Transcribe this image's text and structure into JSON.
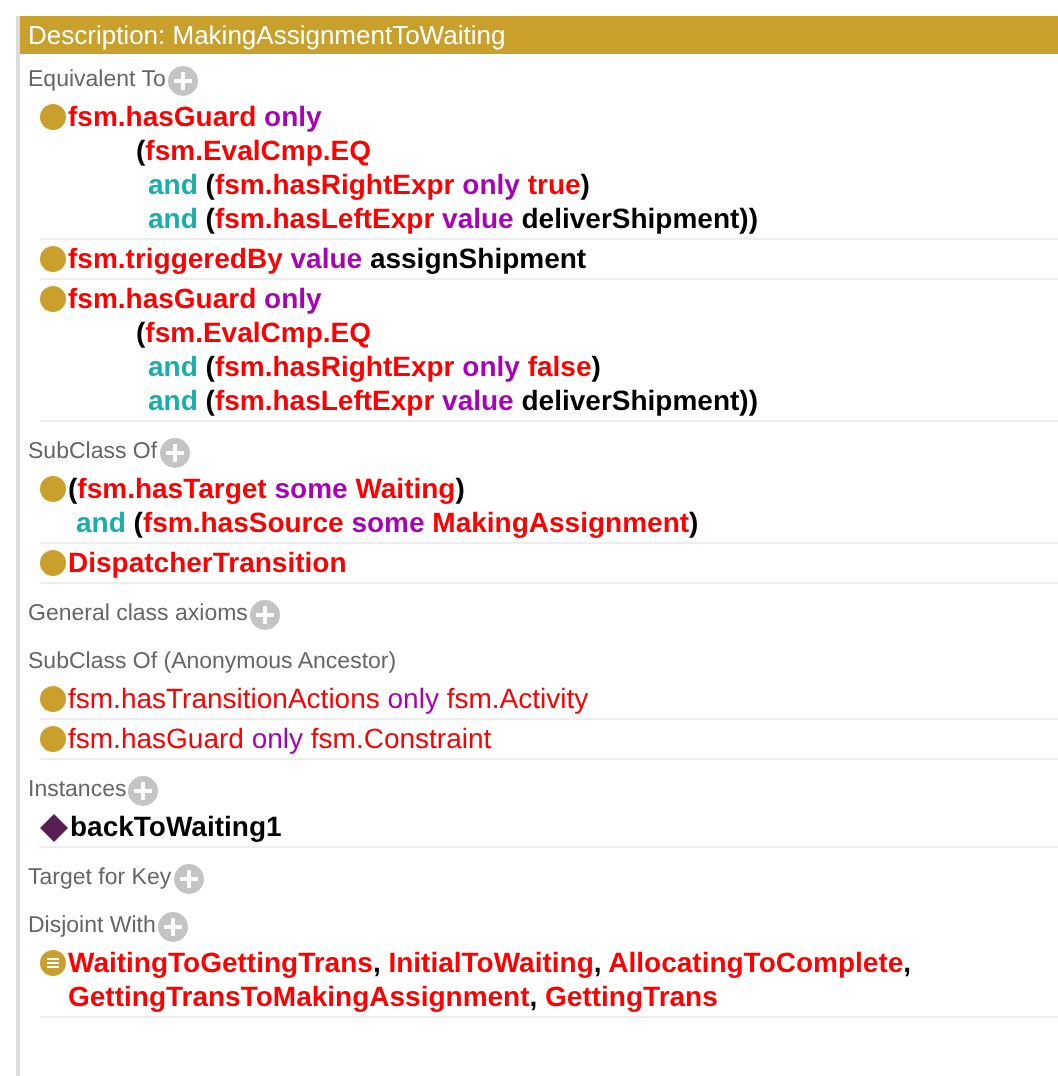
{
  "panel": {
    "title": "Description: MakingAssignmentToWaiting"
  },
  "sections": [
    {
      "label": "Equivalent To",
      "addable": true,
      "items": [
        {
          "kind": "class",
          "inherited": false,
          "lines": [
            {
              "kind": "head",
              "tokens": [
                {
                  "t": "fsm.hasGuard",
                  "kind": "entity"
                },
                {
                  "t": " only",
                  "kind": "keyword"
                }
              ]
            },
            {
              "kind": "group",
              "tokens": [
                {
                  "t": "(",
                  "kind": "plain"
                },
                {
                  "t": "fsm.EvalCmp.EQ",
                  "kind": "entity"
                }
              ]
            },
            {
              "kind": "clause",
              "tokens": [
                {
                  "t": "and",
                  "kind": "connective"
                },
                {
                  "t": " (",
                  "kind": "plain"
                },
                {
                  "t": "fsm.hasRightExpr",
                  "kind": "entity"
                },
                {
                  "t": " only",
                  "kind": "keyword"
                },
                {
                  "t": " true",
                  "kind": "entity"
                },
                {
                  "t": ")",
                  "kind": "plain"
                }
              ]
            },
            {
              "kind": "clause",
              "tokens": [
                {
                  "t": "and",
                  "kind": "connective"
                },
                {
                  "t": " (",
                  "kind": "plain"
                },
                {
                  "t": "fsm.hasLeftExpr",
                  "kind": "entity"
                },
                {
                  "t": " value",
                  "kind": "keyword"
                },
                {
                  "t": " deliverShipment))",
                  "kind": "plain"
                }
              ]
            }
          ]
        },
        {
          "kind": "class",
          "inherited": false,
          "lines": [
            {
              "kind": "head",
              "tokens": [
                {
                  "t": "fsm.triggeredBy",
                  "kind": "entity"
                },
                {
                  "t": " value",
                  "kind": "keyword"
                },
                {
                  "t": " assignShipment",
                  "kind": "plain"
                }
              ]
            }
          ]
        },
        {
          "kind": "class",
          "inherited": false,
          "lines": [
            {
              "kind": "head",
              "tokens": [
                {
                  "t": "fsm.hasGuard",
                  "kind": "entity"
                },
                {
                  "t": " only",
                  "kind": "keyword"
                }
              ]
            },
            {
              "kind": "group",
              "tokens": [
                {
                  "t": "(",
                  "kind": "plain"
                },
                {
                  "t": "fsm.EvalCmp.EQ",
                  "kind": "entity"
                }
              ]
            },
            {
              "kind": "clause",
              "tokens": [
                {
                  "t": "and",
                  "kind": "connective"
                },
                {
                  "t": " (",
                  "kind": "plain"
                },
                {
                  "t": "fsm.hasRightExpr",
                  "kind": "entity"
                },
                {
                  "t": " only",
                  "kind": "keyword"
                },
                {
                  "t": " false",
                  "kind": "entity"
                },
                {
                  "t": ")",
                  "kind": "plain"
                }
              ]
            },
            {
              "kind": "clause",
              "tokens": [
                {
                  "t": "and",
                  "kind": "connective"
                },
                {
                  "t": " (",
                  "kind": "plain"
                },
                {
                  "t": "fsm.hasLeftExpr",
                  "kind": "entity"
                },
                {
                  "t": " value",
                  "kind": "keyword"
                },
                {
                  "t": " deliverShipment))",
                  "kind": "plain"
                }
              ]
            }
          ]
        }
      ]
    },
    {
      "label": "SubClass Of",
      "addable": true,
      "items": [
        {
          "kind": "class",
          "inherited": false,
          "lines": [
            {
              "kind": "head",
              "tokens": [
                {
                  "t": "(",
                  "kind": "plain"
                },
                {
                  "t": "fsm.hasTarget",
                  "kind": "entity"
                },
                {
                  "t": " some",
                  "kind": "keyword"
                },
                {
                  "t": " Waiting",
                  "kind": "entity"
                },
                {
                  "t": ")",
                  "kind": "plain"
                }
              ]
            },
            {
              "kind": "cont",
              "tokens": [
                {
                  "t": "and",
                  "kind": "connective"
                },
                {
                  "t": " (",
                  "kind": "plain"
                },
                {
                  "t": "fsm.hasSource",
                  "kind": "entity"
                },
                {
                  "t": " some",
                  "kind": "keyword"
                },
                {
                  "t": " MakingAssignment",
                  "kind": "entity"
                },
                {
                  "t": ")",
                  "kind": "plain"
                }
              ]
            }
          ]
        },
        {
          "kind": "class",
          "inherited": false,
          "lines": [
            {
              "kind": "head",
              "tokens": [
                {
                  "t": "DispatcherTransition",
                  "kind": "entity"
                }
              ]
            }
          ]
        }
      ]
    },
    {
      "label": "General class axioms",
      "addable": true
    },
    {
      "label": "SubClass Of (Anonymous Ancestor)",
      "addable": false,
      "items": [
        {
          "kind": "class",
          "inherited": true,
          "lines": [
            {
              "kind": "head",
              "tokens": [
                {
                  "t": "fsm.hasTransitionActions",
                  "kind": "entity"
                },
                {
                  "t": " only",
                  "kind": "keyword"
                },
                {
                  "t": " fsm.Activity",
                  "kind": "entity"
                }
              ]
            }
          ]
        },
        {
          "kind": "class",
          "inherited": true,
          "lines": [
            {
              "kind": "head",
              "tokens": [
                {
                  "t": "fsm.hasGuard",
                  "kind": "entity"
                },
                {
                  "t": " only",
                  "kind": "keyword"
                },
                {
                  "t": " fsm.Constraint",
                  "kind": "entity"
                }
              ]
            }
          ]
        }
      ]
    },
    {
      "label": "Instances",
      "addable": true,
      "items": [
        {
          "kind": "individual",
          "inherited": false,
          "lines": [
            {
              "kind": "head",
              "tokens": [
                {
                  "t": "backToWaiting1",
                  "kind": "plain"
                }
              ]
            }
          ]
        }
      ]
    },
    {
      "label": "Target for Key",
      "addable": true
    },
    {
      "label": "Disjoint With",
      "addable": true,
      "items": [
        {
          "kind": "disjoint",
          "inherited": false,
          "lines": [
            {
              "kind": "head",
              "tokens": [
                {
                  "t": "WaitingToGettingTrans",
                  "kind": "entity"
                },
                {
                  "t": ", ",
                  "kind": "plain"
                },
                {
                  "t": "InitialToWaiting",
                  "kind": "entity"
                },
                {
                  "t": ", ",
                  "kind": "plain"
                },
                {
                  "t": "AllocatingToComplete",
                  "kind": "entity"
                },
                {
                  "t": ",",
                  "kind": "plain"
                }
              ]
            },
            {
              "kind": "head",
              "tokens": [
                {
                  "t": "GettingTransToMakingAssignment",
                  "kind": "entity"
                },
                {
                  "t": ", ",
                  "kind": "plain"
                },
                {
                  "t": "GettingTrans",
                  "kind": "entity"
                }
              ]
            }
          ]
        }
      ]
    }
  ]
}
